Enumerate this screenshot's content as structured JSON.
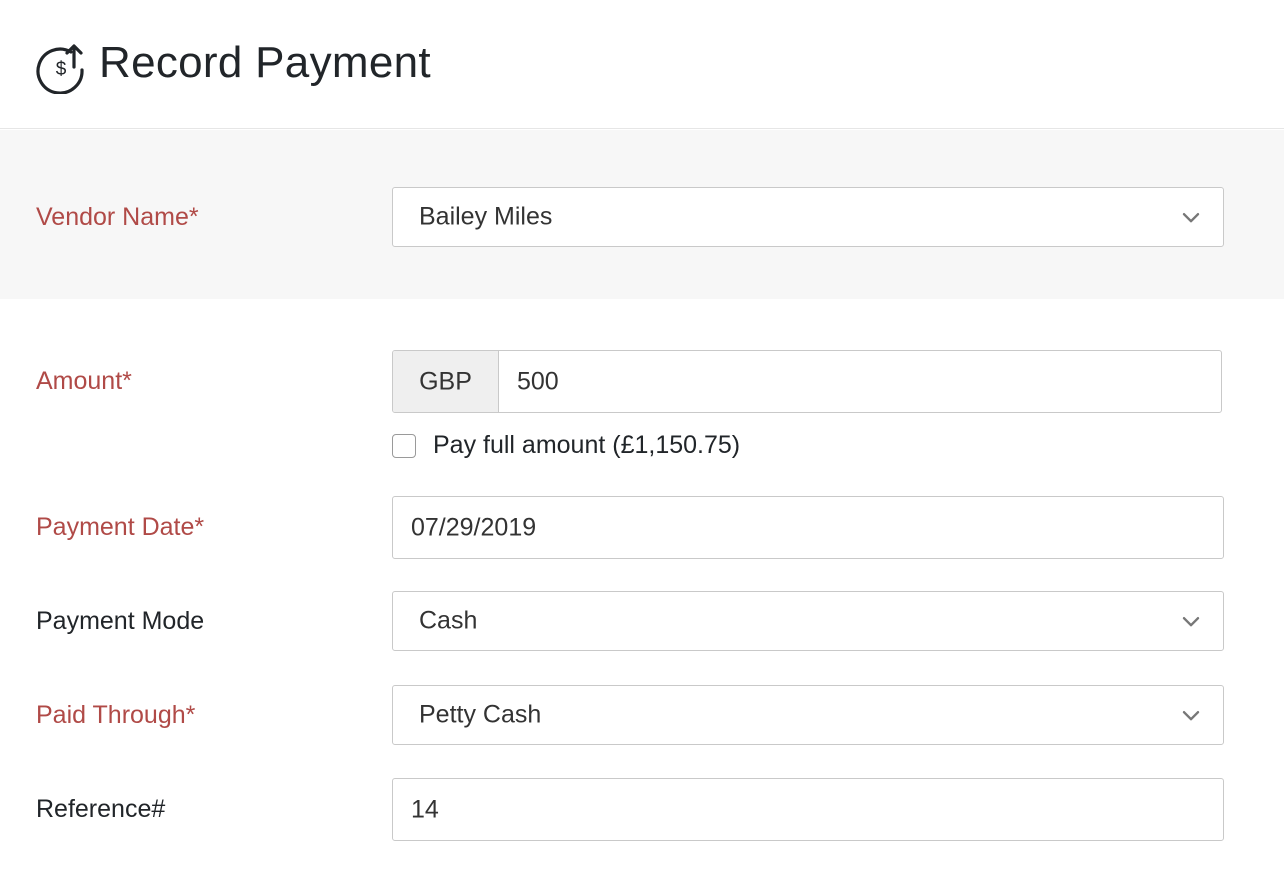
{
  "header": {
    "title": "Record Payment",
    "icon": "payment-dollar-arrow-icon"
  },
  "colors": {
    "required_label": "#b04a47",
    "band": "#f7f7f7",
    "border": "#c9c9c9"
  },
  "form": {
    "vendor": {
      "label": "Vendor Name*",
      "value": "Bailey Miles"
    },
    "amount": {
      "label": "Amount*",
      "currency": "GBP",
      "value": "500",
      "pay_full_label": "Pay full amount (£1,150.75)",
      "pay_full_checked": false
    },
    "payment_date": {
      "label": "Payment Date*",
      "value": "07/29/2019"
    },
    "payment_mode": {
      "label": "Payment Mode",
      "value": "Cash"
    },
    "paid_through": {
      "label": "Paid Through*",
      "value": "Petty Cash"
    },
    "reference": {
      "label": "Reference#",
      "value": "14"
    }
  }
}
